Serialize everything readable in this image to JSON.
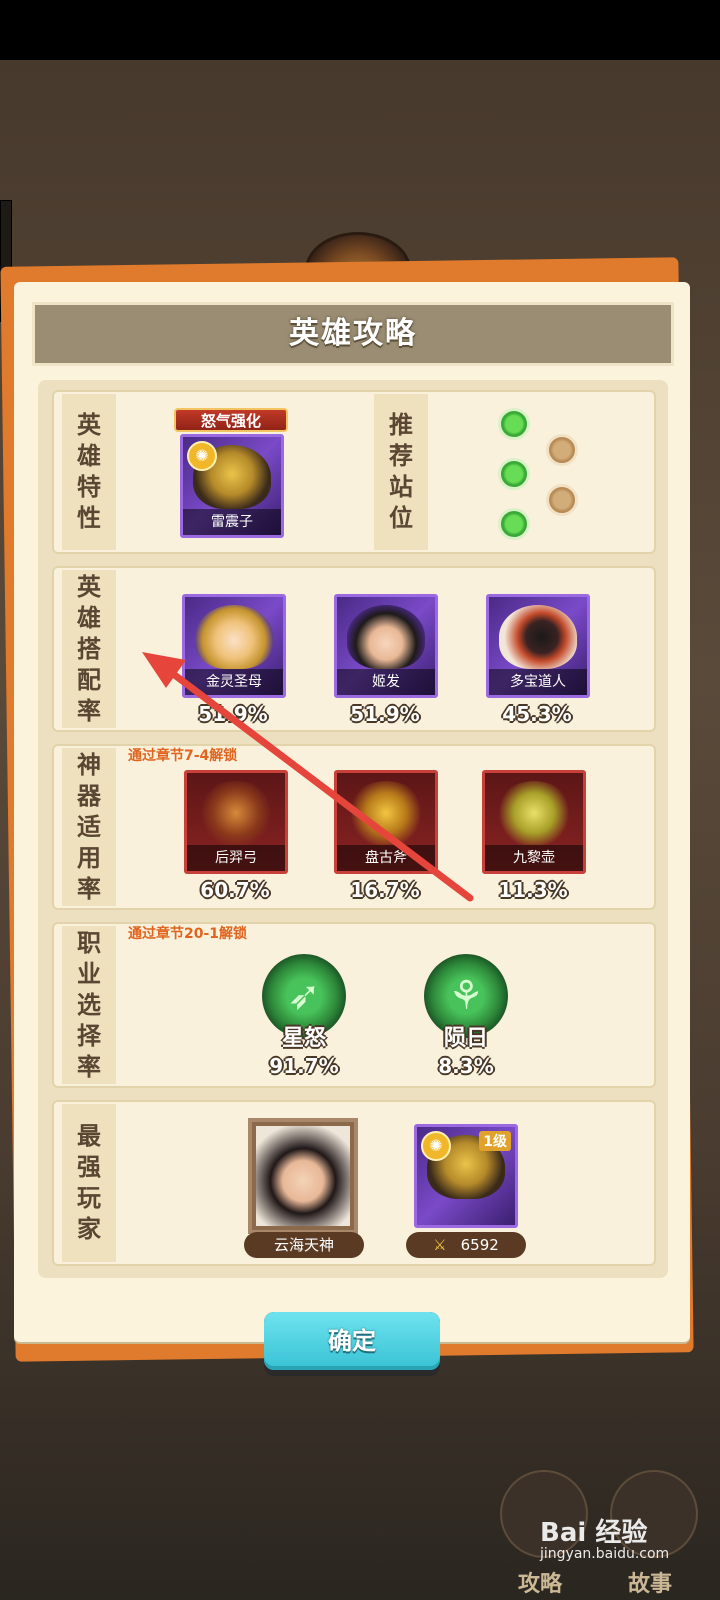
{
  "header": {
    "title": "英雄攻略"
  },
  "traits": {
    "label": [
      "英",
      "雄",
      "特",
      "性"
    ],
    "banner": "怒气强化",
    "hero_name": "雷震子",
    "position_label": [
      "推",
      "荐",
      "站",
      "位"
    ]
  },
  "pairing": {
    "label": [
      "英",
      "雄",
      "搭",
      "配",
      "率"
    ],
    "heroes": [
      {
        "name": "金灵圣母",
        "rate": "51.9%"
      },
      {
        "name": "姬发",
        "rate": "51.9%"
      },
      {
        "name": "多宝道人",
        "rate": "45.3%"
      }
    ]
  },
  "artifact": {
    "label": [
      "神",
      "器",
      "适",
      "用",
      "率"
    ],
    "unlock": "通过章节7-4解锁",
    "items": [
      {
        "name": "后羿弓",
        "rate": "60.7%"
      },
      {
        "name": "盘古斧",
        "rate": "16.7%"
      },
      {
        "name": "九黎壶",
        "rate": "11.3%"
      }
    ]
  },
  "job": {
    "label": [
      "职",
      "业",
      "选",
      "择",
      "率"
    ],
    "unlock": "通过章节20-1解锁",
    "items": [
      {
        "name": "星怒",
        "rate": "91.7%"
      },
      {
        "name": "陨日",
        "rate": "8.3%"
      }
    ]
  },
  "top_player": {
    "label": [
      "最",
      "强",
      "玩",
      "家"
    ],
    "player_name": "云海天神",
    "level_badge": "1级",
    "power": "6592"
  },
  "confirm_label": "确定",
  "bottom_tabs": {
    "left": "攻略",
    "right": "故事"
  },
  "watermark": {
    "brand": "Bai 经验",
    "url": "jingyan.baidu.com"
  },
  "colors": {
    "accent": "#e07a2c",
    "parchment": "#fbf3dc",
    "confirm": "#37c2d4",
    "arrow": "#e5453a"
  }
}
